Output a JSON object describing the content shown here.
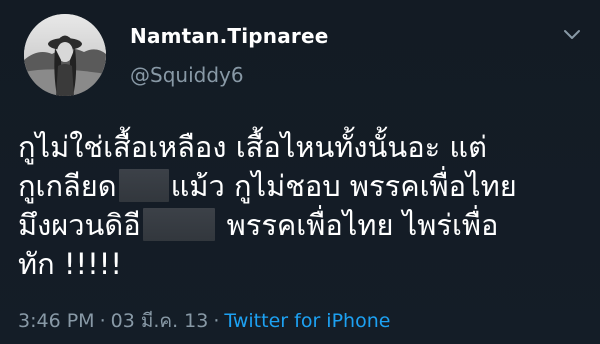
{
  "tweet": {
    "display_name": "Namtan.Tipnaree",
    "handle": "@Squiddy6",
    "lines": [
      [
        "กูไม่ใช่เสื้อเหลือง เสื้อไหนทั้งนั้นอะ แต่"
      ],
      [
        "กูเกลียด",
        "แม้ว กูไม่ชอบ พรรคเพื่อไทย"
      ],
      [
        "มึงผวนดิอี",
        "พรรคเพื่อไทย ไพร่เพื่อ"
      ],
      [
        "ทัก !!!!!"
      ]
    ],
    "time": "3:46 PM",
    "date": "03 มี.ค. 13",
    "separator": "·",
    "source": "Twitter for iPhone"
  },
  "icons": {
    "more": "chevron-down-icon"
  },
  "colors": {
    "background": "#141d26",
    "text": "#ffffff",
    "muted": "#8899a6",
    "link": "#1da1f2",
    "censor": "#383d43"
  }
}
